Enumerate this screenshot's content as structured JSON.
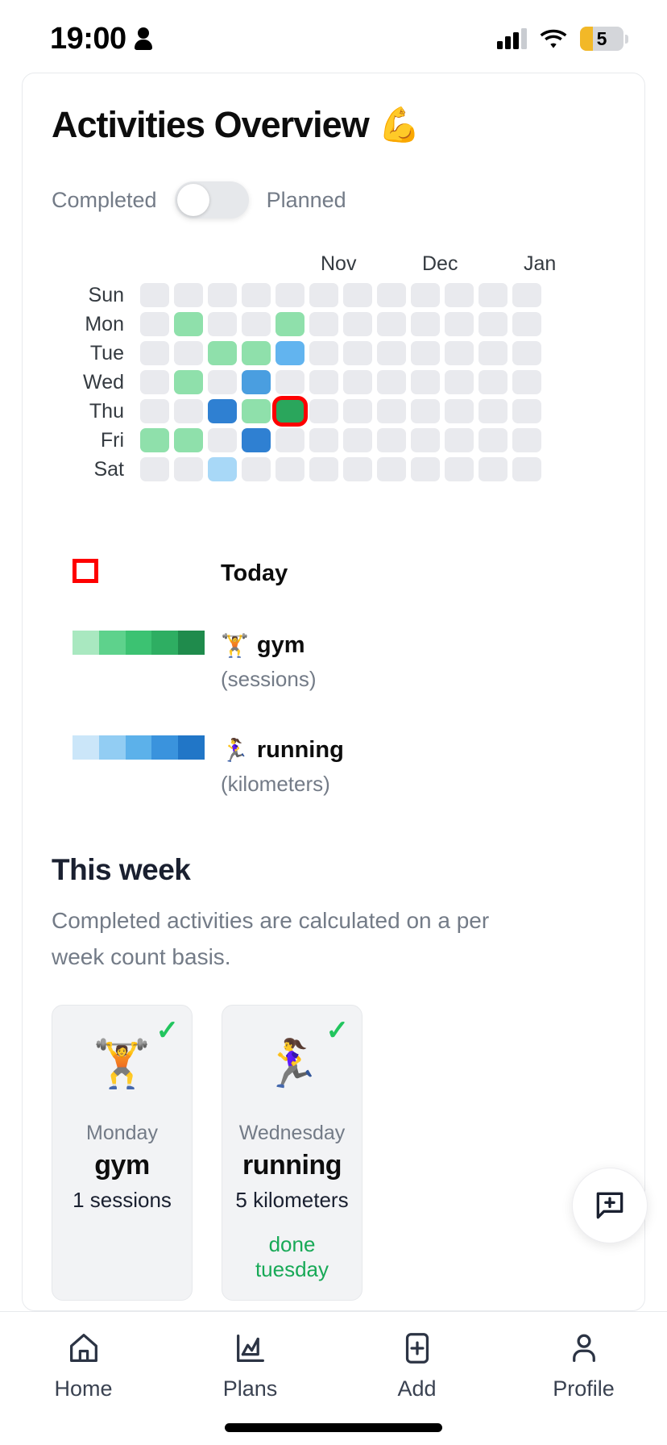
{
  "status_bar": {
    "time": "19:00",
    "person_icon": "person-icon",
    "signal_icon": "cellular-signal-icon",
    "wifi_icon": "wifi-icon",
    "battery_level": "5",
    "battery_icon": "battery-icon"
  },
  "header": {
    "title": "Activities Overview",
    "title_emoji": "💪"
  },
  "toggle": {
    "left_label": "Completed",
    "right_label": "Planned",
    "selected": "Completed",
    "knob_position": "left"
  },
  "heatmap": {
    "months": [
      "Nov",
      "Dec",
      "Jan"
    ],
    "days": [
      "Sun",
      "Mon",
      "Tue",
      "Wed",
      "Thu",
      "Fri",
      "Sat"
    ],
    "columns": 12,
    "empty_color": "#e9eaee",
    "today": {
      "row": "Thu",
      "col": 4,
      "outline_color": "#fe0000"
    },
    "cells": [
      {
        "row": 0,
        "values": [
          null,
          null,
          null,
          null,
          null,
          null,
          null,
          null,
          null,
          null,
          null,
          null
        ]
      },
      {
        "row": 1,
        "values": [
          null,
          "#8fe0ab",
          null,
          null,
          "#8fe0ab",
          null,
          null,
          null,
          null,
          null,
          null,
          null
        ]
      },
      {
        "row": 2,
        "values": [
          null,
          null,
          "#8fe0ab",
          "#8fe0ab",
          "#62b4ef",
          null,
          null,
          null,
          null,
          null,
          null,
          null
        ]
      },
      {
        "row": 3,
        "values": [
          null,
          "#8fe0ab",
          null,
          "#4a9ee0",
          null,
          null,
          null,
          null,
          null,
          null,
          null,
          null
        ]
      },
      {
        "row": 4,
        "values": [
          null,
          null,
          "#2f80d2",
          "#8fe0ab",
          "#2aa65c",
          null,
          null,
          null,
          null,
          null,
          null,
          null
        ]
      },
      {
        "row": 5,
        "values": [
          "#8fe0ab",
          "#8fe0ab",
          null,
          "#2f80d2",
          null,
          null,
          null,
          null,
          null,
          null,
          null,
          null
        ]
      },
      {
        "row": 6,
        "values": [
          null,
          null,
          "#a8d8f7",
          null,
          null,
          null,
          null,
          null,
          null,
          null,
          null,
          null
        ]
      }
    ]
  },
  "legend": {
    "today": {
      "label": "Today",
      "swatch": "red-outline-square"
    },
    "gym": {
      "emoji": "🏋️",
      "label": "gym",
      "unit": "(sessions)",
      "scale": [
        "#a9e8c0",
        "#5ed28c",
        "#3cc272",
        "#2eae62",
        "#1f8b4c"
      ]
    },
    "running": {
      "emoji": "🏃‍♀️",
      "label": "running",
      "unit": "(kilometers)",
      "scale": [
        "#cbe6f9",
        "#92cdf3",
        "#5cb1ea",
        "#3a93dd",
        "#2176c7"
      ]
    }
  },
  "this_week": {
    "heading": "This week",
    "description": "Completed activities are calculated on a per week count basis.",
    "cards": [
      {
        "emoji": "🏋️",
        "check": "✓",
        "day": "Monday",
        "name": "gym",
        "metric": "1 sessions",
        "note": ""
      },
      {
        "emoji": "🏃‍♀️",
        "check": "✓",
        "day": "Wednesday",
        "name": "running",
        "metric": "5 kilometers",
        "note": "done tuesday"
      }
    ]
  },
  "fab": {
    "icon": "chat-add-icon",
    "label": ""
  },
  "bottom_nav": {
    "items": [
      {
        "icon": "home-icon",
        "label": "Home"
      },
      {
        "icon": "chart-icon",
        "label": "Plans"
      },
      {
        "icon": "plus-box-icon",
        "label": "Add"
      },
      {
        "icon": "person-icon",
        "label": "Profile"
      }
    ]
  },
  "colors": {
    "accent_green": "#18a957",
    "check_green": "#22c55e",
    "today_red": "#fe0000",
    "muted_text": "#737b87"
  }
}
